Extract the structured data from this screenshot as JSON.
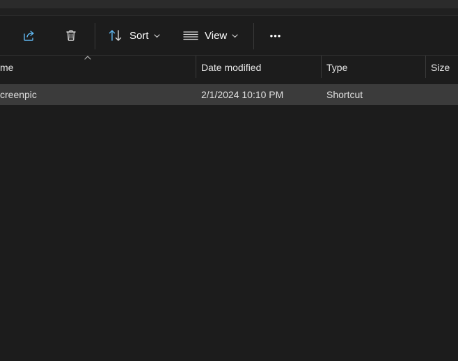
{
  "toolbar": {
    "share_icon": "share-icon",
    "delete_icon": "trash-icon",
    "sort_label": "Sort",
    "view_label": "View",
    "more_label": "•••"
  },
  "columns": {
    "name": "me",
    "date_modified": "Date modified",
    "type": "Type",
    "size": "Size"
  },
  "rows": [
    {
      "name": "creenpic",
      "date_modified": "2/1/2024 10:10 PM",
      "type": "Shortcut",
      "size": ""
    }
  ],
  "colors": {
    "background": "#1c1c1c",
    "selected_row": "#3b3b3b",
    "accent_icon": "#60b7f0"
  }
}
